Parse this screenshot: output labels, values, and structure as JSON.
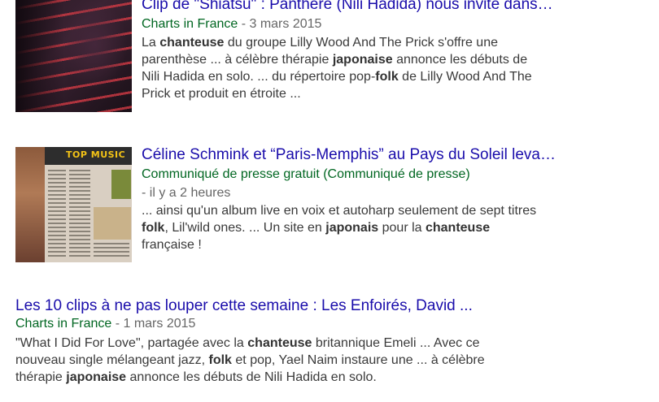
{
  "results": [
    {
      "title": "Clip de \"Shiatsu\" : Panthère (Nili Hadida) nous invite dans…",
      "source": "Charts in France",
      "separator": " - ",
      "date": "3 mars 2015",
      "snippet_lines": [
        [
          {
            "t": "La "
          },
          {
            "t": "chanteuse",
            "b": true
          },
          {
            "t": " du groupe Lilly Wood And The Prick s'offre une"
          }
        ],
        [
          {
            "t": "parenthèse ... à célèbre thérapie "
          },
          {
            "t": "japonaise",
            "b": true
          },
          {
            "t": " annonce les débuts de"
          }
        ],
        [
          {
            "t": "Nili Hadida en solo. ... du répertoire pop-"
          },
          {
            "t": "folk",
            "b": true
          },
          {
            "t": " de Lilly Wood And The"
          }
        ],
        [
          {
            "t": "Prick et produit en étroite ..."
          }
        ]
      ]
    },
    {
      "title": "Céline Schmink et “Paris-Memphis” au Pays du Soleil leva…",
      "source": "Communiqué de presse gratuit (Communiqué de presse)",
      "date": " - il y a 2 heures",
      "thumb_logo": "TOP MUSIC",
      "snippet_lines": [
        [
          {
            "t": "... ainsi qu'un album live en voix et autoharp seulement de sept titres"
          }
        ],
        [
          {
            "t": "folk",
            "b": true
          },
          {
            "t": ", Lil'wild ones. ... Un site en "
          },
          {
            "t": "japonais",
            "b": true
          },
          {
            "t": " pour la "
          },
          {
            "t": "chanteuse",
            "b": true
          }
        ],
        [
          {
            "t": "française !"
          }
        ]
      ]
    },
    {
      "title": "Les 10 clips à ne pas louper cette semaine : Les Enfoirés, David ...",
      "source": "Charts in France",
      "separator": " - ",
      "date": "1 mars 2015",
      "snippet_lines": [
        [
          {
            "t": "\"What I Did For Love\", partagée avec la "
          },
          {
            "t": "chanteuse",
            "b": true
          },
          {
            "t": " britannique Emeli ... Avec ce"
          }
        ],
        [
          {
            "t": "nouveau single mélangeant jazz, "
          },
          {
            "t": "folk",
            "b": true
          },
          {
            "t": " et pop, Yael Naim instaure une ... à célèbre"
          }
        ],
        [
          {
            "t": "thérapie "
          },
          {
            "t": "japonaise",
            "b": true
          },
          {
            "t": " annonce les débuts de Nili Hadida en solo."
          }
        ]
      ]
    }
  ]
}
